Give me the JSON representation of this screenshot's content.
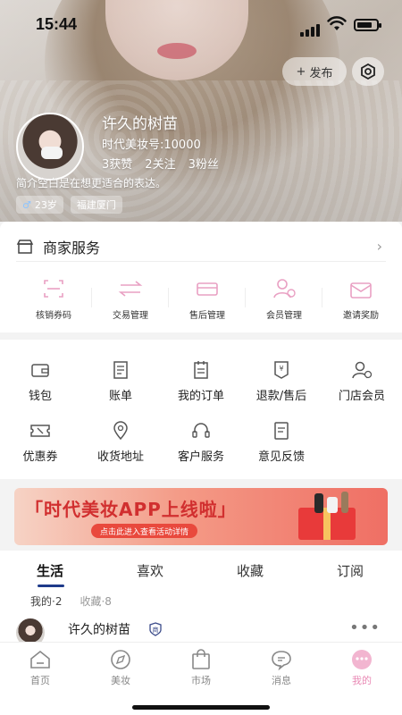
{
  "status_bar": {
    "time": "15:44"
  },
  "header": {
    "post_label": "发布",
    "post_plus": "+",
    "nickname": "许久的树苗",
    "meid": "时代美妆号:10000",
    "stats": [
      {
        "value": "3",
        "label": "获赞"
      },
      {
        "value": "2",
        "label": "关注"
      },
      {
        "value": "3",
        "label": "粉丝"
      }
    ],
    "bio": "简介空白是在想更适合的表达。",
    "tags": {
      "age": "23岁",
      "gender_symbol": "♂",
      "location": "福建厦门"
    }
  },
  "merchant": {
    "title": "商家服务",
    "chevron": "›",
    "items": [
      {
        "label": "核销券码",
        "icon": "scan-icon"
      },
      {
        "label": "交易管理",
        "icon": "exchange-icon"
      },
      {
        "label": "售后管理",
        "icon": "aftersale-icon"
      },
      {
        "label": "会员管理",
        "icon": "member-icon"
      },
      {
        "label": "邀请奖励",
        "icon": "invite-icon"
      }
    ]
  },
  "services": {
    "row1": [
      {
        "label": "钱包",
        "icon": "wallet-icon"
      },
      {
        "label": "账单",
        "icon": "bill-icon"
      },
      {
        "label": "我的订单",
        "icon": "order-icon"
      },
      {
        "label": "退款/售后",
        "icon": "refund-icon"
      },
      {
        "label": "门店会员",
        "icon": "store-member-icon"
      }
    ],
    "row2": [
      {
        "label": "优惠券",
        "icon": "coupon-icon"
      },
      {
        "label": "收货地址",
        "icon": "location-icon"
      },
      {
        "label": "客户服务",
        "icon": "headset-icon"
      },
      {
        "label": "意见反馈",
        "icon": "feedback-icon"
      }
    ]
  },
  "banner": {
    "title": "「时代美妆APP上线啦」",
    "subtitle": "点击此进入查看活动详情"
  },
  "tabs": {
    "items": [
      "生活",
      "喜欢",
      "收藏",
      "订阅"
    ],
    "active": "生活",
    "sub": {
      "mine": "我的·2",
      "collect": "收藏·8"
    }
  },
  "post": {
    "name": "许久的树苗",
    "badge": "商",
    "more": "•••"
  },
  "bottom_nav": [
    {
      "label": "首页",
      "icon": "home-icon"
    },
    {
      "label": "美妆",
      "icon": "compass-icon"
    },
    {
      "label": "市场",
      "icon": "bag-icon"
    },
    {
      "label": "消息",
      "icon": "message-icon"
    },
    {
      "label": "我的",
      "icon": "profile-icon"
    }
  ],
  "colors": {
    "accent_pink": "#e98ab5",
    "tab_indicator": "#1e3a8a",
    "banner_red": "#d12f2f"
  }
}
